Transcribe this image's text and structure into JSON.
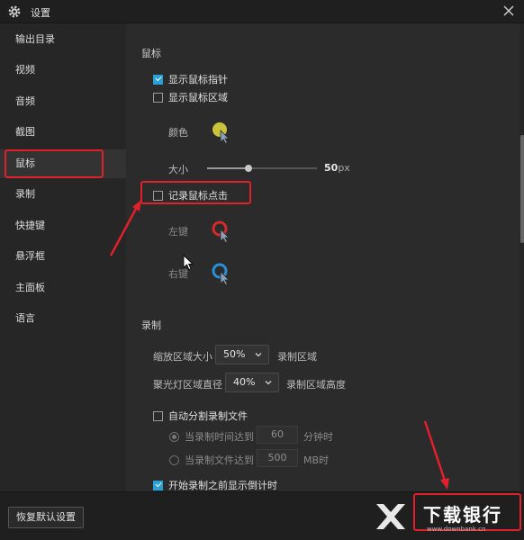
{
  "window": {
    "title": "设置"
  },
  "sidebar": {
    "items": [
      {
        "label": "输出目录"
      },
      {
        "label": "视频"
      },
      {
        "label": "音频"
      },
      {
        "label": "截图"
      },
      {
        "label": "鼠标"
      },
      {
        "label": "录制"
      },
      {
        "label": "快捷键"
      },
      {
        "label": "悬浮框"
      },
      {
        "label": "主面板"
      },
      {
        "label": "语言"
      }
    ],
    "active": "鼠标"
  },
  "mouse": {
    "section_title": "鼠标",
    "show_pointer": {
      "label": "显示鼠标指针",
      "checked": true
    },
    "show_area": {
      "label": "显示鼠标区域",
      "checked": false
    },
    "color_label": "颜色",
    "size_label": "大小",
    "size": {
      "value": "50",
      "unit": "px",
      "fraction": 0.38
    },
    "record_click": {
      "label": "记录鼠标点击",
      "checked": false
    },
    "left_label": "左键",
    "right_label": "右键",
    "colors": {
      "area": "#c9c23a",
      "left": "#d62a2a",
      "right": "#2a8fd6"
    }
  },
  "record": {
    "section_title": "录制",
    "zoom_label": "缩放区域大小",
    "zoom_value": "50%",
    "zoom_suffix": "录制区域",
    "spotlight_label": "聚光灯区域直径",
    "spotlight_value": "40%",
    "spotlight_suffix": "录制区域高度",
    "auto_split": {
      "label": "自动分割录制文件",
      "checked": false
    },
    "split_time": {
      "label": "当录制时间达到",
      "value": "60",
      "unit": "分钟时"
    },
    "split_size": {
      "label": "当录制文件达到",
      "value": "500",
      "unit": "MB时"
    },
    "countdown": {
      "label": "开始录制之前显示倒计时",
      "checked": true
    }
  },
  "footer": {
    "restore_label": "恢复默认设置"
  },
  "watermark": {
    "text": "下载银行",
    "url": "www.downbank.cn"
  },
  "accent": "#29a0d8",
  "highlight": "#e0202a"
}
